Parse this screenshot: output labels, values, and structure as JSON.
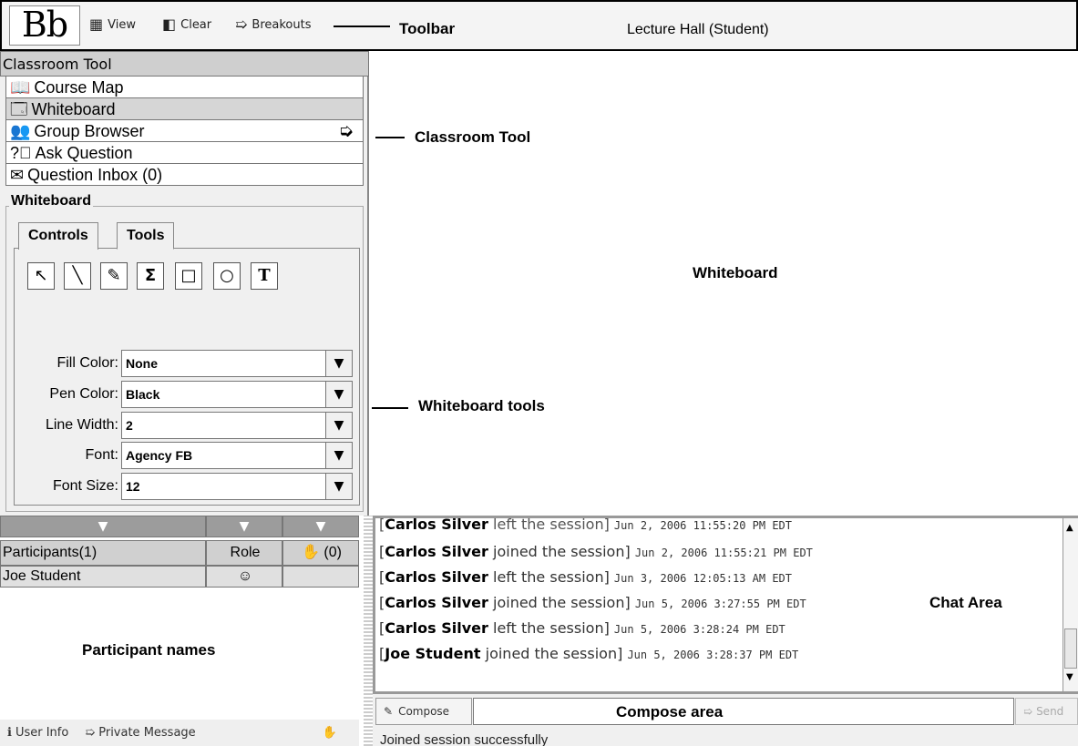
{
  "toolbar": {
    "logo": "Bb",
    "view_label": "View",
    "clear_label": "Clear",
    "breakouts_label": "Breakouts",
    "window_title": "Lecture Hall (Student)"
  },
  "annotations": {
    "toolbar": "Toolbar",
    "classroom_tool": "Classroom Tool",
    "whiteboard": "Whiteboard",
    "whiteboard_tools": "Whiteboard  tools",
    "participant_names": "Participant names",
    "chat_area": "Chat Area",
    "compose_area": "Compose area"
  },
  "classroom_tool": {
    "header": "Classroom Tool",
    "items": [
      {
        "label": "Course Map",
        "icon": "book-icon"
      },
      {
        "label": "Whiteboard",
        "icon": "whiteboard-icon",
        "selected": true
      },
      {
        "label": "Group Browser",
        "icon": "group-icon"
      },
      {
        "label": "Ask Question",
        "icon": "question-icon"
      },
      {
        "label": "Question Inbox (0)",
        "icon": "inbox-icon"
      }
    ]
  },
  "whiteboard_panel": {
    "title": "Whiteboard",
    "tabs": [
      "Controls",
      "Tools"
    ],
    "active_tab": "Tools",
    "tools": [
      "select-tool-icon",
      "line-tool-icon",
      "pen-tool-icon",
      "equation-tool-icon",
      "rectangle-tool-icon",
      "ellipse-tool-icon",
      "text-tool-icon"
    ],
    "properties": [
      {
        "label": "Fill Color:",
        "value": "None"
      },
      {
        "label": "Pen Color:",
        "value": "Black"
      },
      {
        "label": "Line Width:",
        "value": "2"
      },
      {
        "label": "Font:",
        "value": "Agency FB"
      },
      {
        "label": "Font Size:",
        "value": "12"
      }
    ]
  },
  "participants": {
    "col_name": "Participants(1)",
    "col_role": "Role",
    "col_hand": "(0)",
    "rows": [
      {
        "name": "Joe Student"
      }
    ],
    "footer_user_info": "User Info",
    "footer_private_message": "Private Message"
  },
  "chat": {
    "lines": [
      {
        "name": "Carlos Silver",
        "action": " left the session]",
        "ts": "Jun 2, 2006 11:55:20 PM EDT"
      },
      {
        "name": "Carlos Silver",
        "action": " joined the session]",
        "ts": "Jun 2, 2006 11:55:21 PM EDT"
      },
      {
        "name": "Carlos Silver",
        "action": " left the session]",
        "ts": "Jun 3, 2006 12:05:13 AM EDT"
      },
      {
        "name": "Carlos Silver",
        "action": " joined the session]",
        "ts": "Jun 5, 2006 3:27:55 PM EDT"
      },
      {
        "name": "Carlos Silver",
        "action": " left the session]",
        "ts": "Jun 5, 2006 3:28:24 PM EDT"
      },
      {
        "name": "Joe Student",
        "action": " joined the session]",
        "ts": "Jun 5, 2006 3:28:37 PM EDT"
      }
    ],
    "compose_label": "Compose",
    "send_label": "Send",
    "status": "Joined session successfully"
  }
}
